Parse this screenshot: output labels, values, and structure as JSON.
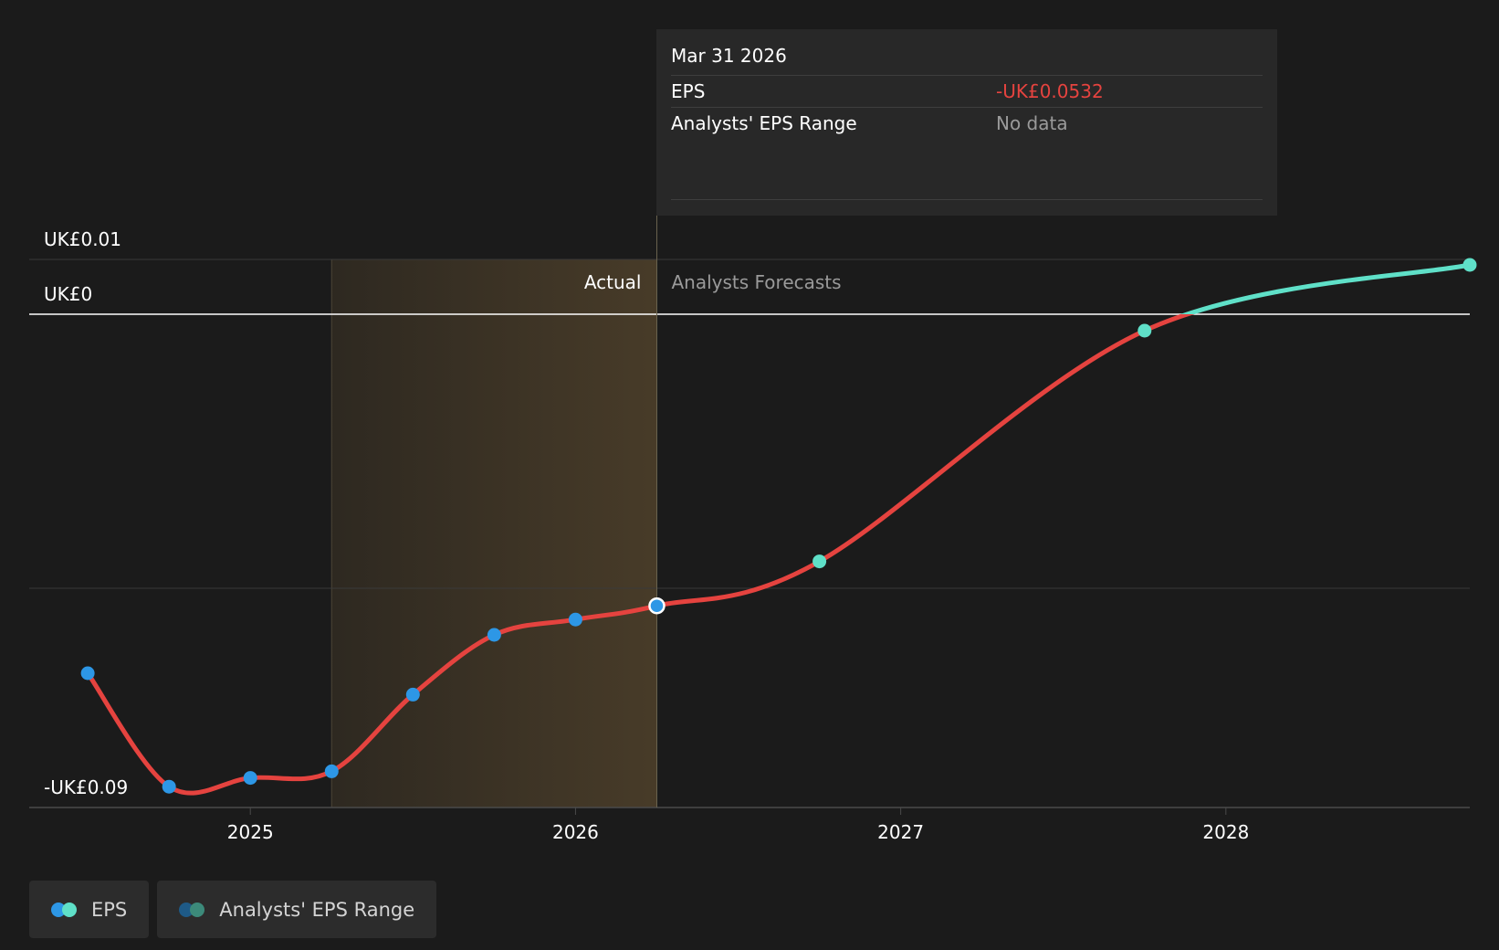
{
  "tooltip": {
    "date": "Mar 31 2026",
    "rows": [
      {
        "label": "EPS",
        "value": "-UK£0.0532"
      },
      {
        "label": "Analysts' EPS Range",
        "value": "No data"
      }
    ]
  },
  "legend": [
    {
      "label": "EPS",
      "colors": [
        "#2d97e6",
        "#5fe0c8"
      ]
    },
    {
      "label": "Analysts' EPS Range",
      "colors": [
        "#1e5a87",
        "#3c8a7a"
      ]
    }
  ],
  "colors": {
    "background": "#1b1b1b",
    "eps_line": "#e5433f",
    "actual_point": "#2d97e6",
    "forecast_point": "#5fe0c8",
    "forecast_line": "#5fe0c8",
    "actual_band": "#4a3d29"
  },
  "chart_data": {
    "type": "line",
    "y_tick_labels": [
      {
        "value": 0.01,
        "label": "UK£0.01"
      },
      {
        "value": 0,
        "label": "UK£0"
      },
      {
        "value": -0.09,
        "label": "-UK£0.09"
      }
    ],
    "x_tick_labels": [
      {
        "value": 2025.0,
        "label": "2025"
      },
      {
        "value": 2026.0,
        "label": "2026"
      },
      {
        "value": 2027.0,
        "label": "2027"
      },
      {
        "value": 2028.0,
        "label": "2028"
      }
    ],
    "xlim": [
      2024.32,
      2028.75
    ],
    "ylim": [
      -0.09,
      0.01
    ],
    "grid_y": [
      0.01,
      -0.05
    ],
    "zero_line": 0,
    "region_labels": {
      "actual": "Actual",
      "forecast": "Analysts Forecasts"
    },
    "actual_band": [
      2025.25,
      2026.25
    ],
    "selected_x": 2026.25,
    "series": [
      {
        "name": "EPS",
        "actual": [
          {
            "x": 2024.5,
            "y": -0.0655
          },
          {
            "x": 2024.75,
            "y": -0.0862
          },
          {
            "x": 2025.0,
            "y": -0.0846
          },
          {
            "x": 2025.25,
            "y": -0.0834
          },
          {
            "x": 2025.5,
            "y": -0.0694
          },
          {
            "x": 2025.75,
            "y": -0.0585
          },
          {
            "x": 2026.0,
            "y": -0.0557
          },
          {
            "x": 2026.25,
            "y": -0.0532
          }
        ],
        "forecast": [
          {
            "x": 2026.75,
            "y": -0.0451
          },
          {
            "x": 2027.75,
            "y": -0.003
          },
          {
            "x": 2028.75,
            "y": 0.009
          }
        ]
      }
    ]
  }
}
